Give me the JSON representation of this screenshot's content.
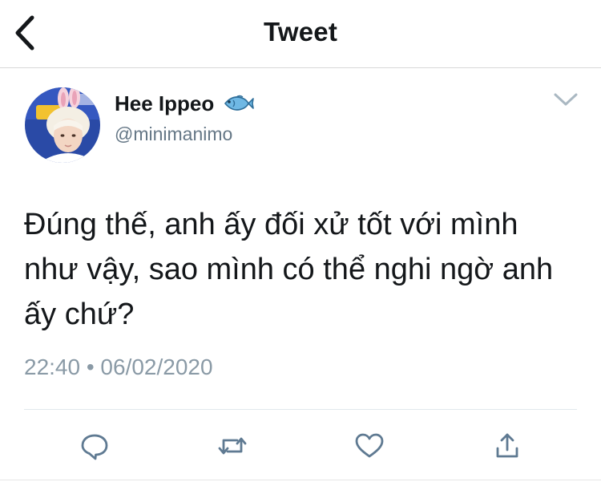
{
  "header": {
    "title": "Tweet",
    "back_icon": "chevron-left-icon"
  },
  "tweet": {
    "author": {
      "display_name": "Hee Ippeo",
      "emoji": "fish-icon",
      "handle": "@minimanimo"
    },
    "text": "Đúng thế, anh ấy đối xử tốt với mình như vậy, sao mình có thể nghi ngờ anh ấy chứ?",
    "timestamp": "22:40 • 06/02/2020"
  },
  "actions": [
    "reply-icon",
    "retweet-icon",
    "like-icon",
    "share-icon"
  ],
  "colors": {
    "text": "#14171a",
    "secondary": "#657786",
    "icon": "#5f7a92",
    "divider": "#e1e8ed"
  }
}
